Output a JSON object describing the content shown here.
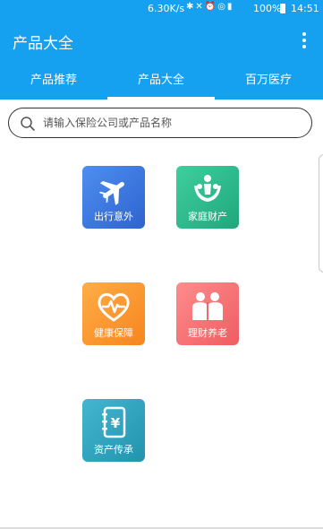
{
  "status_bar": {
    "net_speed": "6.30K/s",
    "battery": "100%",
    "time": "14:51"
  },
  "app_bar": {
    "title": "产品大全"
  },
  "tabs": [
    {
      "label": "产品推荐",
      "selected": false
    },
    {
      "label": "产品大全",
      "selected": true
    },
    {
      "label": "百万医疗",
      "selected": false
    }
  ],
  "search": {
    "placeholder": "请输入保险公司或产品名称",
    "value": ""
  },
  "categories": [
    {
      "label": "出行意外",
      "icon": "airplane-icon",
      "color": "#3f7ee6"
    },
    {
      "label": "家庭财产",
      "icon": "family-icon",
      "color": "#2dbb8c"
    },
    {
      "label": "健康保障",
      "icon": "heart-pulse-icon",
      "color": "#fb9830"
    },
    {
      "label": "理财养老",
      "icon": "elderly-couple-icon",
      "color": "#f57479"
    },
    {
      "label": "资产传承",
      "icon": "yen-ledger-icon",
      "color": "#33a5c0"
    }
  ],
  "colors": {
    "primary": "#15a0f0"
  }
}
